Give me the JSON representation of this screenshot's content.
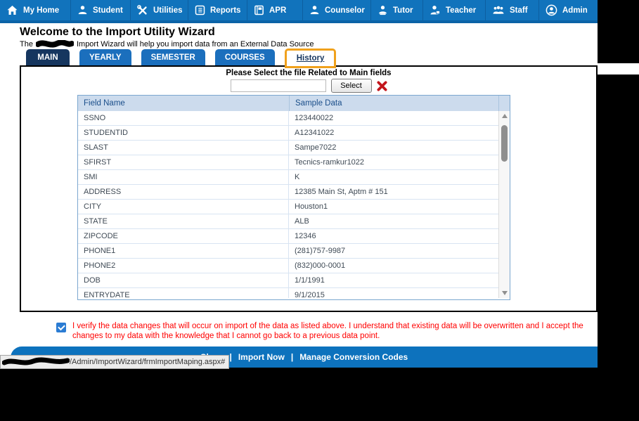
{
  "nav": {
    "items": [
      {
        "label": "My Home",
        "icon": "home-icon"
      },
      {
        "label": "Student",
        "icon": "student-icon"
      },
      {
        "label": "Utilities",
        "icon": "utilities-icon"
      },
      {
        "label": "Reports",
        "icon": "reports-icon"
      },
      {
        "label": "APR",
        "icon": "apr-icon"
      },
      {
        "label": "Counselor",
        "icon": "counselor-icon"
      },
      {
        "label": "Tutor",
        "icon": "tutor-icon"
      },
      {
        "label": "Teacher",
        "icon": "teacher-icon"
      },
      {
        "label": "Staff",
        "icon": "staff-icon"
      },
      {
        "label": "Admin",
        "icon": "admin-icon"
      }
    ]
  },
  "header": {
    "title": "Welcome to the Import Utility Wizard",
    "subtitle_prefix": "The",
    "subtitle_suffix": "Import Wizard will help you import data from an External Data Source"
  },
  "tabs": [
    {
      "label": "MAIN",
      "active": true
    },
    {
      "label": "YEARLY",
      "active": false
    },
    {
      "label": "SEMESTER",
      "active": false
    },
    {
      "label": "COURSES",
      "active": false
    },
    {
      "label": "History",
      "active": false,
      "highlighted": true
    }
  ],
  "file_select": {
    "prompt": "Please Select the file Related to Main fields",
    "input_value": "",
    "button_label": "Select"
  },
  "table": {
    "columns": {
      "field": "Field Name",
      "sample": "Sample Data"
    },
    "rows": [
      {
        "field": "SSNO",
        "sample": "123440022"
      },
      {
        "field": "STUDENTID",
        "sample": "A12341022"
      },
      {
        "field": "SLAST",
        "sample": "Sampe7022"
      },
      {
        "field": "SFIRST",
        "sample": "Tecnics-ramkur1022"
      },
      {
        "field": "SMI",
        "sample": "K"
      },
      {
        "field": "ADDRESS",
        "sample": "12385 Main St, Aptm # 151"
      },
      {
        "field": "CITY",
        "sample": "Houston1"
      },
      {
        "field": "STATE",
        "sample": "ALB"
      },
      {
        "field": "ZIPCODE",
        "sample": "12346"
      },
      {
        "field": "PHONE1",
        "sample": "(281)757-9987"
      },
      {
        "field": "PHONE2",
        "sample": "(832)000-0001"
      },
      {
        "field": "DOB",
        "sample": "1/1/1991"
      },
      {
        "field": "ENTRYDATE",
        "sample": "9/1/2015"
      }
    ]
  },
  "verify": {
    "checked": true,
    "text": "I verify the data changes that will occur on import of the data as listed above. I understand that existing data will be overwritten and I accept the changes to my data with the knowledge that I cannot go back to a previous data point."
  },
  "footer": {
    "links": [
      "Close",
      "Import Now",
      "Manage Conversion Codes"
    ],
    "separator": "|"
  },
  "statusbar": {
    "url_visible": "/Admin/ImportWizard/frmImportMaping.aspx#"
  },
  "colors": {
    "nav_blue": "#1173bc",
    "tab_active_navy": "#16365f",
    "tab_blue": "#1b6fbd",
    "highlight_orange": "#f0a11c",
    "table_header_bg": "#ccdbed",
    "table_header_text": "#1a4e8a",
    "verify_red": "#ff0000",
    "footer_blue": "#0d72bd"
  }
}
